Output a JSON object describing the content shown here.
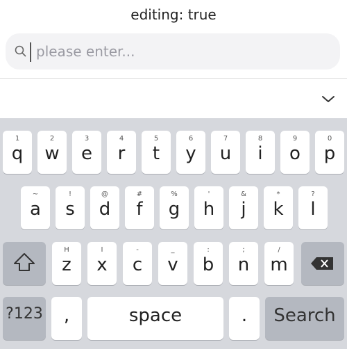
{
  "status": {
    "text": "editing: true"
  },
  "search": {
    "placeholder": "please enter..."
  },
  "keyboard": {
    "row1": [
      {
        "hint": "1",
        "key": "q"
      },
      {
        "hint": "2",
        "key": "w"
      },
      {
        "hint": "3",
        "key": "e"
      },
      {
        "hint": "4",
        "key": "r"
      },
      {
        "hint": "5",
        "key": "t"
      },
      {
        "hint": "6",
        "key": "y"
      },
      {
        "hint": "7",
        "key": "u"
      },
      {
        "hint": "8",
        "key": "i"
      },
      {
        "hint": "9",
        "key": "o"
      },
      {
        "hint": "0",
        "key": "p"
      }
    ],
    "row2": [
      {
        "hint": "~",
        "key": "a"
      },
      {
        "hint": "!",
        "key": "s"
      },
      {
        "hint": "@",
        "key": "d"
      },
      {
        "hint": "#",
        "key": "f"
      },
      {
        "hint": "%",
        "key": "g"
      },
      {
        "hint": "'",
        "key": "h"
      },
      {
        "hint": "&",
        "key": "j"
      },
      {
        "hint": "*",
        "key": "k"
      },
      {
        "hint": "?",
        "key": "l"
      }
    ],
    "row3": [
      {
        "hint": "H",
        "key": "z"
      },
      {
        "hint": "I",
        "key": "x"
      },
      {
        "hint": "-",
        "key": "c"
      },
      {
        "hint": "_",
        "key": "v"
      },
      {
        "hint": ":",
        "key": "b"
      },
      {
        "hint": ";",
        "key": "n"
      },
      {
        "hint": "/",
        "key": "m"
      }
    ],
    "symbols_label": "?123",
    "comma_label": ",",
    "space_label": "space",
    "period_label": ".",
    "search_label": "Search"
  },
  "colors": {
    "keyboard_bg": "#d6d8dd",
    "key_bg": "#ffffff",
    "function_key_bg": "#b4b8c0"
  }
}
